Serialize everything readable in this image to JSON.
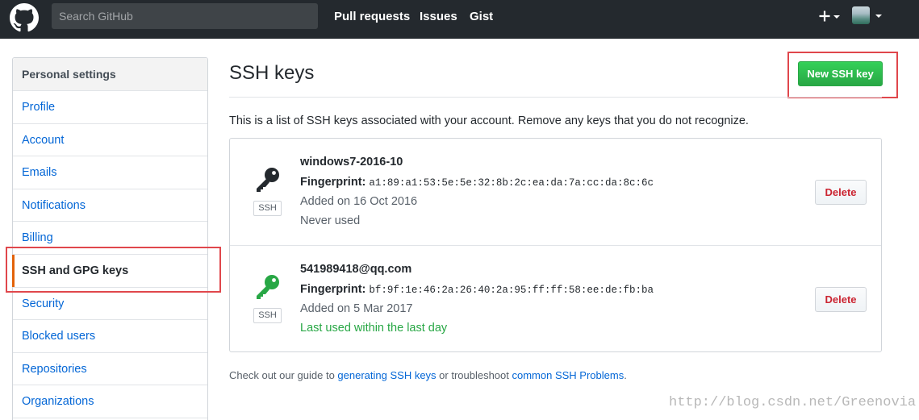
{
  "header": {
    "search_placeholder": "Search GitHub",
    "nav": [
      "Pull requests",
      "Issues",
      "Gist"
    ],
    "plus_symbol": "+"
  },
  "sidebar": {
    "heading": "Personal settings",
    "items": [
      {
        "label": "Profile"
      },
      {
        "label": "Account"
      },
      {
        "label": "Emails"
      },
      {
        "label": "Notifications"
      },
      {
        "label": "Billing"
      },
      {
        "label": "SSH and GPG keys",
        "active": true
      },
      {
        "label": "Security"
      },
      {
        "label": "Blocked users"
      },
      {
        "label": "Repositories"
      },
      {
        "label": "Organizations"
      }
    ]
  },
  "main": {
    "title": "SSH keys",
    "new_button": "New SSH key",
    "intro": "This is a list of SSH keys associated with your account. Remove any keys that you do not recognize.",
    "fingerprint_label": "Fingerprint:",
    "badge": "SSH",
    "delete_label": "Delete",
    "keys": [
      {
        "title": "windows7-2016-10",
        "fingerprint": "a1:89:a1:53:5e:5e:32:8b:2c:ea:da:7a:cc:da:8c:6c",
        "added": "Added on 16 Oct 2016",
        "usage": "Never used",
        "icon_color": "#24292e"
      },
      {
        "title": "541989418@qq.com",
        "fingerprint": "bf:9f:1e:46:2a:26:40:2a:95:ff:ff:58:ee:de:fb:ba",
        "added": "Added on 5 Mar 2017",
        "usage": "Last used within the last day",
        "icon_color": "#28a745"
      }
    ],
    "footer": {
      "prefix": "Check out our guide to ",
      "link1": "generating SSH keys",
      "middle": " or troubleshoot ",
      "link2": "common SSH Problems",
      "suffix": "."
    }
  },
  "watermark": "http://blog.csdn.net/Greenovia",
  "colors": {
    "header_bg": "#24292e",
    "link": "#0366d6",
    "primary_button": "#28a745",
    "delete_text": "#cb2431",
    "annotation_box": "#e0474c",
    "active_marker": "#e36209"
  }
}
